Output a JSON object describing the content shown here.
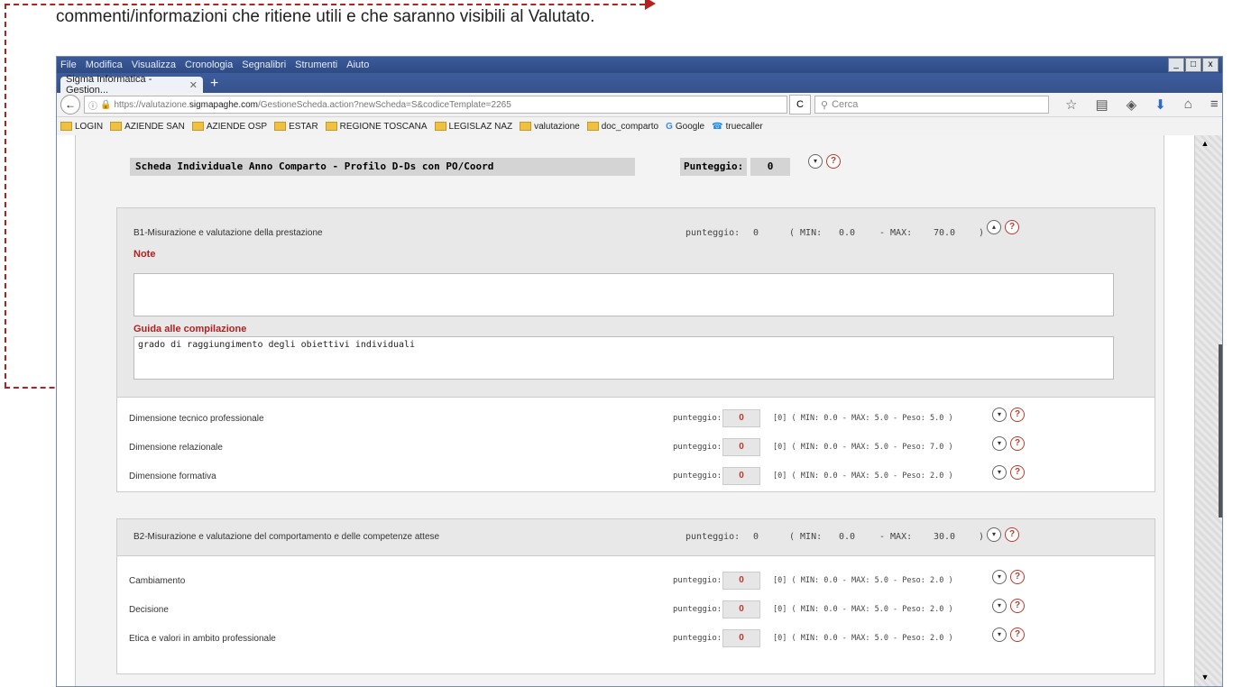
{
  "document": {
    "caption": "commenti/informazioni che ritiene utili e che saranno visibili al Valutato."
  },
  "browser": {
    "menu": [
      "File",
      "Modifica",
      "Visualizza",
      "Cronologia",
      "Segnalibri",
      "Strumenti",
      "Aiuto"
    ],
    "tab_title": "Sigma Informatica - Gestion...",
    "url_prefix": "https://valutazione.",
    "url_domain": "sigmapaghe.com",
    "url_path": "/GestioneScheda.action?newScheda=S&codiceTemplate=2265",
    "search_placeholder": "Cerca",
    "bookmarks": [
      "LOGIN",
      "AZIENDE SAN",
      "AZIENDE OSP",
      "ESTAR",
      "REGIONE TOSCANA",
      "LEGISLAZ NAZ",
      "valutazione",
      "doc_comparto",
      "Google",
      "truecaller"
    ],
    "window_controls": [
      "_",
      " ",
      "x"
    ]
  },
  "sheet": {
    "title": "Scheda Individuale Anno Comparto - Profilo D-Ds con PO/Coord",
    "score_label": "Punteggio:",
    "score_value": "0"
  },
  "sections": [
    {
      "title": "B1-Misurazione e valutazione della prestazione",
      "score_label": "punteggio:",
      "score": "0",
      "min_label": "( MIN:",
      "min": "0.0",
      "max_label": "- MAX:",
      "max": "70.0",
      "close": ")",
      "note_label": "Note",
      "note_text": "",
      "guide_label": "Guida alle compilazione",
      "guide_text": "grado di raggiungimento degli obiettivi individuali"
    },
    {
      "title": "B2-Misurazione e valutazione del comportamento  e delle competenze attese",
      "score_label": "punteggio:",
      "score": "0",
      "min_label": "( MIN:",
      "min": "0.0",
      "max_label": "- MAX:",
      "max": "30.0",
      "close": ")"
    }
  ],
  "items_b1": [
    {
      "label": "Dimensione tecnico professionale",
      "score_label": "punteggio:",
      "score": "0",
      "range": "[0] ( MIN: 0.0 - MAX: 5.0 - Peso: 5.0 )"
    },
    {
      "label": "Dimensione relazionale",
      "score_label": "punteggio:",
      "score": "0",
      "range": "[0] ( MIN: 0.0 - MAX: 5.0 - Peso: 7.0 )"
    },
    {
      "label": "Dimensione formativa",
      "score_label": "punteggio:",
      "score": "0",
      "range": "[0] ( MIN: 0.0 - MAX: 5.0 - Peso: 2.0 )"
    }
  ],
  "items_b2": [
    {
      "label": "Cambiamento",
      "score_label": "punteggio:",
      "score": "0",
      "range": "[0] ( MIN: 0.0 - MAX: 5.0 - Peso: 2.0 )"
    },
    {
      "label": "Decisione",
      "score_label": "punteggio:",
      "score": "0",
      "range": "[0] ( MIN: 0.0 - MAX: 5.0 - Peso: 2.0 )"
    },
    {
      "label": "Etica e valori in ambito professionale",
      "score_label": "punteggio:",
      "score": "0",
      "range": "[0] ( MIN: 0.0 - MAX: 5.0 - Peso: 2.0 )"
    }
  ],
  "icons": {
    "collapse": "▾",
    "expand": "▴",
    "help": "?"
  },
  "colors": {
    "accent_red": "#b22222",
    "annotation": "#b52020"
  }
}
